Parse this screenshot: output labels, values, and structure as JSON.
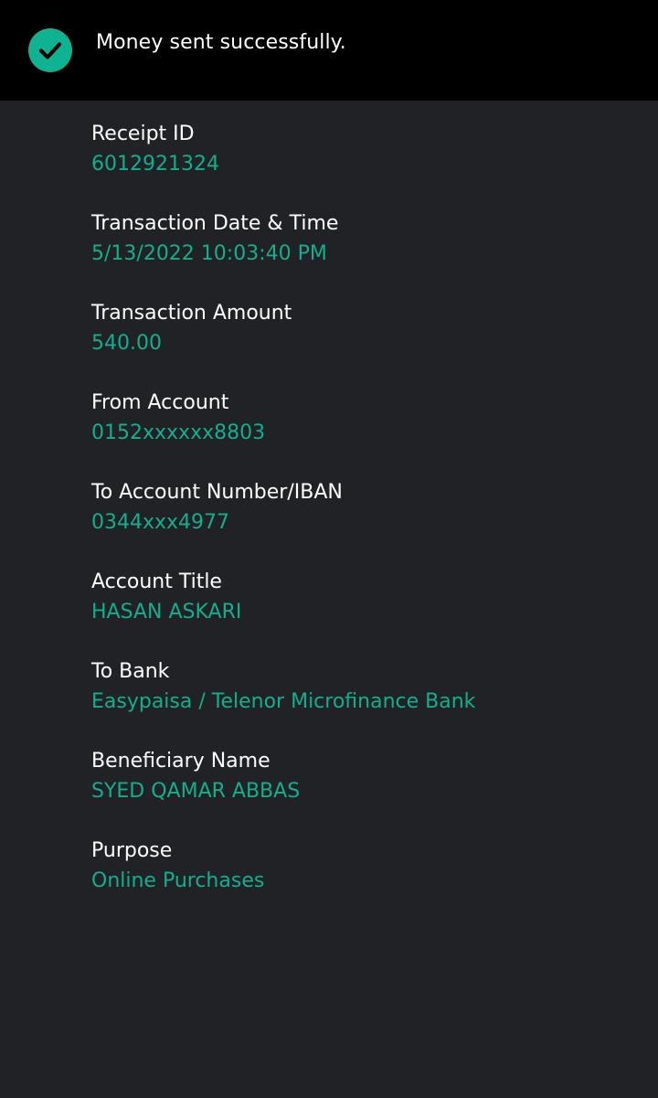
{
  "toast": {
    "icon": "check-circle-icon",
    "message": "Money sent successfully."
  },
  "details": [
    {
      "label": "Receipt ID",
      "value": "6012921324"
    },
    {
      "label": "Transaction Date & Time",
      "value": "5/13/2022 10:03:40 PM"
    },
    {
      "label": "Transaction Amount",
      "value": "540.00"
    },
    {
      "label": "From Account",
      "value": "0152xxxxxx8803"
    },
    {
      "label": "To Account Number/IBAN",
      "value": "0344xxx4977"
    },
    {
      "label": "Account Title",
      "value": "HASAN ASKARI"
    },
    {
      "label": "To Bank",
      "value": "Easypaisa / Telenor Microfinance Bank"
    },
    {
      "label": "Beneficiary Name",
      "value": "SYED QAMAR ABBAS"
    },
    {
      "label": "Purpose",
      "value": "Online Purchases"
    }
  ],
  "colors": {
    "background": "#212226",
    "toast_background": "#000000",
    "accent": "#14ae8f",
    "label": "#ffffff"
  }
}
